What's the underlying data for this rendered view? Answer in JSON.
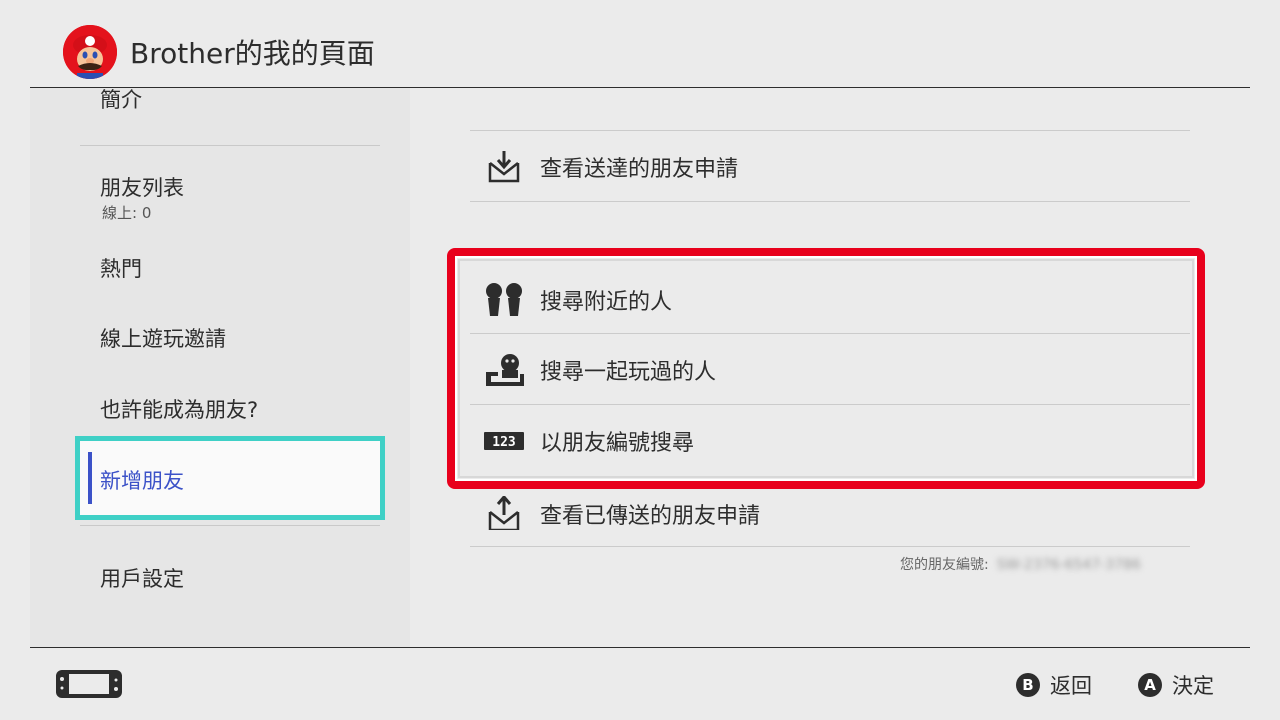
{
  "header": {
    "title": "Brother的我的頁面",
    "avatar_icon": "mario-avatar-icon"
  },
  "sidebar": {
    "items": [
      {
        "label": "簡介"
      },
      {
        "label": "朋友列表",
        "sub": "線上: 0"
      },
      {
        "label": "熱門"
      },
      {
        "label": "線上遊玩邀請"
      },
      {
        "label": "也許能成為朋友?"
      },
      {
        "label": "新增朋友",
        "selected": true
      },
      {
        "label": "用戶設定"
      }
    ]
  },
  "main": {
    "rows": [
      {
        "label": "查看送達的朋友申請",
        "icon": "inbox-download-icon"
      },
      {
        "label": "搜尋附近的人",
        "icon": "nearby-people-icon"
      },
      {
        "label": "搜尋一起玩過的人",
        "icon": "played-with-icon"
      },
      {
        "label": "以朋友編號搜尋",
        "icon": "friend-code-123-icon"
      },
      {
        "label": "查看已傳送的朋友申請",
        "icon": "outbox-upload-icon"
      }
    ],
    "icon_123_text": "123",
    "friend_code_label": "您的朋友編號:",
    "friend_code_value": "SW-2376-6547-3786"
  },
  "footer": {
    "back": {
      "key": "B",
      "label": "返回"
    },
    "ok": {
      "key": "A",
      "label": "決定"
    }
  },
  "colors": {
    "highlight": "#e8001c",
    "selection": "#3fd0c6",
    "selected_text": "#3c52c8"
  }
}
